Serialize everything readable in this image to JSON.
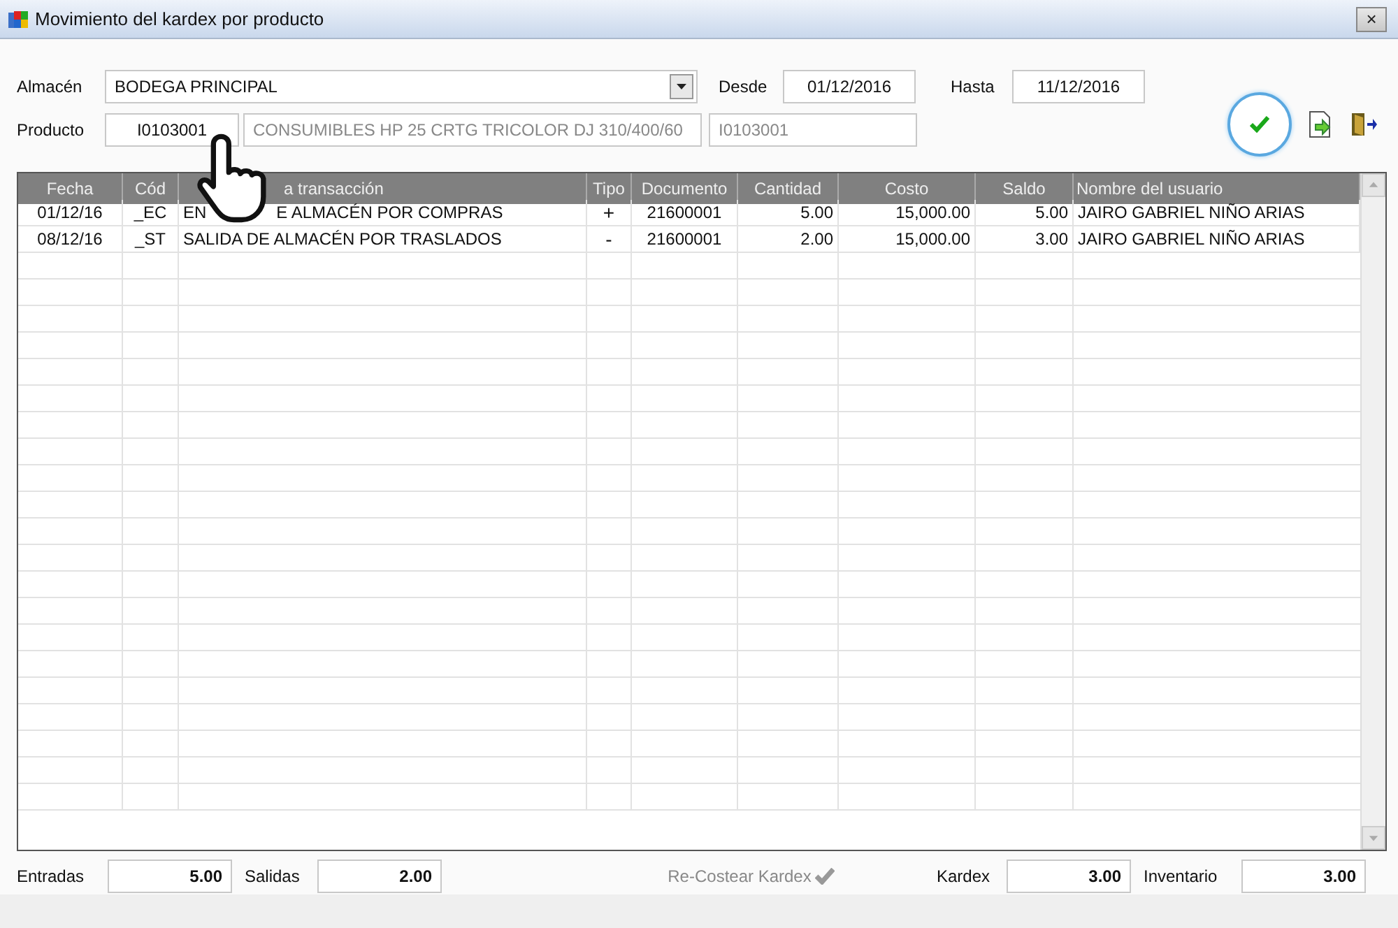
{
  "window": {
    "title": "Movimiento del kardex por producto",
    "close": "×"
  },
  "filters": {
    "almacen": {
      "label": "Almacén",
      "value": "BODEGA PRINCIPAL"
    },
    "desde": {
      "label": "Desde",
      "value": "01/12/2016"
    },
    "hasta": {
      "label": "Hasta",
      "value": "11/12/2016"
    },
    "producto": {
      "label": "Producto",
      "code": "I0103001",
      "description": "CONSUMIBLES HP 25 CRTG TRICOLOR DJ 310/400/60",
      "code_copy": "I0103001"
    }
  },
  "table": {
    "columns": [
      {
        "label": "Fecha"
      },
      {
        "label": "Cód"
      },
      {
        "label": "a transacción"
      },
      {
        "label": "Tipo"
      },
      {
        "label": "Documento"
      },
      {
        "label": "Cantidad"
      },
      {
        "label": "Costo"
      },
      {
        "label": "Saldo"
      },
      {
        "label": "Nombre del usuario"
      }
    ],
    "rows": [
      {
        "fecha": "01/12/16",
        "cod": "_EC",
        "description": [
          "EN",
          "E ALMACÉN POR COMPRAS"
        ],
        "tipo": "+",
        "documento": "21600001",
        "cantidad": "5.00",
        "costo": "15,000.00",
        "saldo": "5.00",
        "usuario": "JAIRO GABRIEL NIÑO ARIAS"
      },
      {
        "fecha": "08/12/16",
        "cod": "_ST",
        "description": [
          "SALIDA DE ALMACÉN POR TRASLADOS"
        ],
        "tipo": "-",
        "documento": "21600001",
        "cantidad": "2.00",
        "costo": "15,000.00",
        "saldo": "3.00",
        "usuario": "JAIRO GABRIEL NIÑO ARIAS"
      }
    ]
  },
  "totals_left": [
    {
      "label": "Entradas",
      "value": "5.00"
    },
    {
      "label": "Salidas",
      "value": "2.00"
    }
  ],
  "recost_button": {
    "label": "Re-Costear Kardex",
    "disabled": true
  },
  "totals_right": [
    {
      "label": "Kardex",
      "value": "3.00"
    },
    {
      "label": "Inventario",
      "value": "3.00"
    }
  ]
}
